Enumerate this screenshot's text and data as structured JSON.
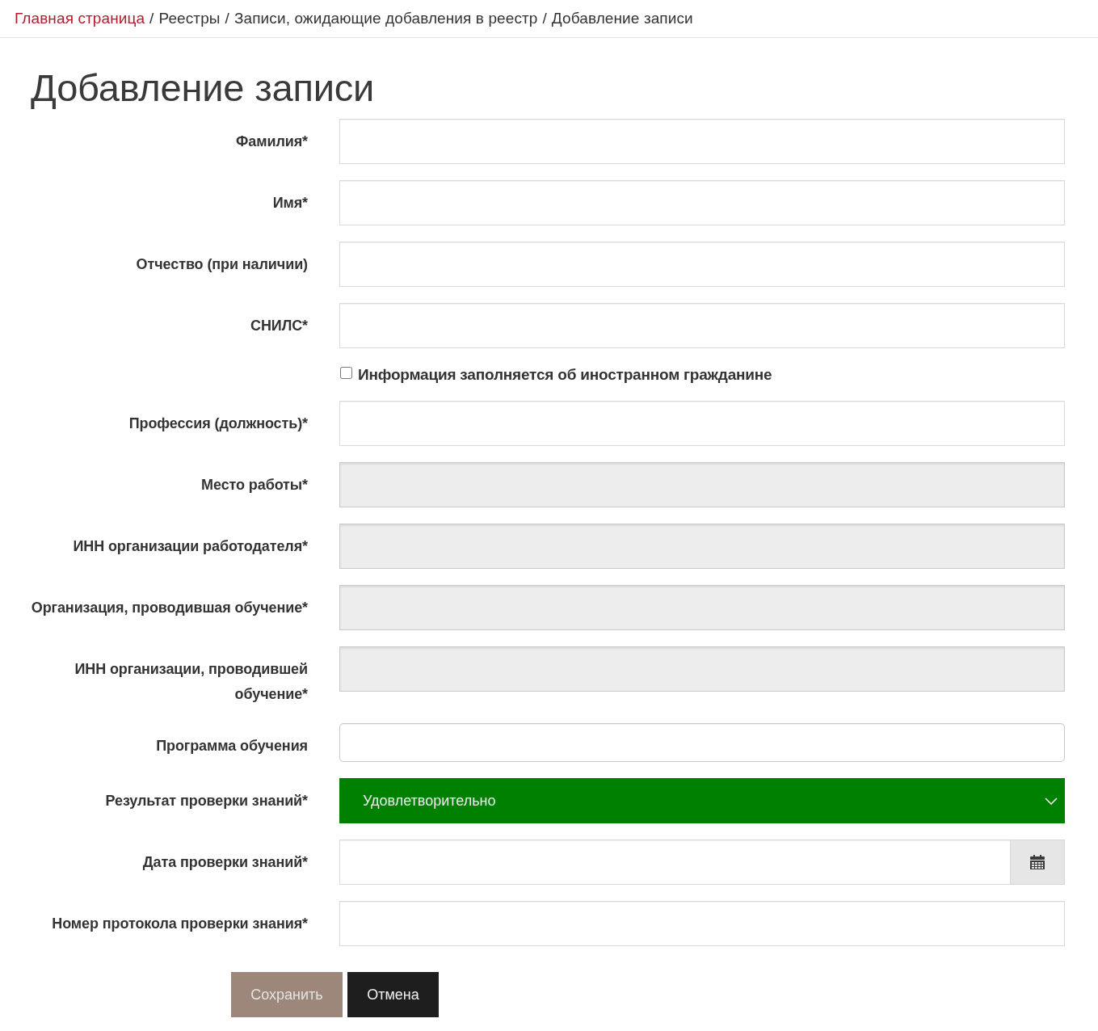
{
  "breadcrumb": [
    {
      "label": "Главная страница",
      "kind": "link"
    },
    {
      "label": "/",
      "kind": "separator"
    },
    {
      "label": "Реестры",
      "kind": "text"
    },
    {
      "label": "/",
      "kind": "separator"
    },
    {
      "label": "Записи, ожидающие добавления в реестр",
      "kind": "text"
    },
    {
      "label": "/",
      "kind": "separator"
    },
    {
      "label": "Добавление записи",
      "kind": "text"
    }
  ],
  "title": "Добавление записи",
  "fields": [
    {
      "kind": "text",
      "label": "Фамилия*",
      "disabled": false
    },
    {
      "kind": "text",
      "label": "Имя*",
      "disabled": false
    },
    {
      "kind": "text",
      "label": "Отчество (при наличии)",
      "disabled": false
    },
    {
      "kind": "text",
      "label": "СНИЛС*",
      "disabled": false
    },
    {
      "kind": "checkbox",
      "label": "Информация заполняется об иностранном гражданине",
      "checked": false
    },
    {
      "kind": "text",
      "label": "Профессия (должность)*",
      "disabled": false
    },
    {
      "kind": "text",
      "label": "Место работы*",
      "disabled": true
    },
    {
      "kind": "text",
      "label": "ИНН организации работодателя*",
      "disabled": true
    },
    {
      "kind": "text",
      "label": "Организация, проводившая обучение*",
      "disabled": true
    },
    {
      "kind": "text",
      "label": "ИНН организации, проводившей обучение*",
      "disabled": true
    },
    {
      "kind": "autocomplete",
      "label": "Программа обучения",
      "disabled": false
    },
    {
      "kind": "select",
      "label": "Результат проверки знаний*",
      "value": "Удовлетворительно"
    },
    {
      "kind": "date",
      "label": "Дата проверки знаний*"
    },
    {
      "kind": "text",
      "label": "Номер протокола проверки знания*",
      "disabled": false
    }
  ],
  "buttons": [
    {
      "label": "Сохранить",
      "kind": "primary"
    },
    {
      "label": "Отмена",
      "kind": "secondary"
    }
  ]
}
